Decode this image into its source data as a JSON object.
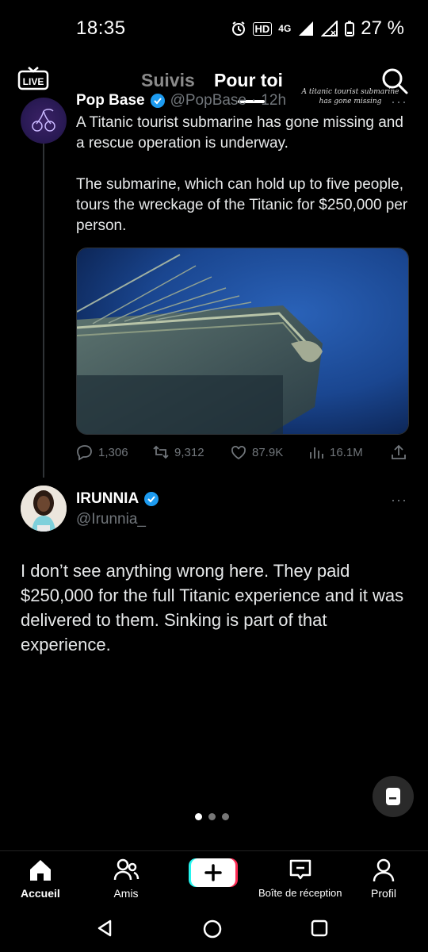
{
  "status_bar": {
    "time": "18:35",
    "network_label": "4G",
    "volte_label": "HD",
    "battery_percent": "27 %"
  },
  "top_nav": {
    "live_label": "LIVE",
    "tabs": [
      {
        "label": "Suivis",
        "active": false
      },
      {
        "label": "Pour toi",
        "active": true
      }
    ],
    "search_caption": "A titanic tourist submarine has gone missing"
  },
  "tweet": {
    "author_name": "Pop Base",
    "author_handle": "@PopBase",
    "time_ago": "12h",
    "text_p1": "A Titanic tourist submarine has gone missing and a rescue operation is underway.",
    "text_p2": "The submarine, which can hold up to five people, tours the wreckage of the Titanic for $250,000 per person.",
    "image_alt": "Titanic wreck bow",
    "replies": "1,306",
    "retweets": "9,312",
    "likes": "87.9K",
    "views": "16.1M",
    "more": "···"
  },
  "reply": {
    "author_name": "IRUNNIA",
    "author_handle": "@Irunnia_",
    "text": "I don’t see anything wrong here. They paid $250,000 for the full Titanic experience and it was delivered to them. Sinking is part of that experience.",
    "more": "···"
  },
  "pager": {
    "count": 3,
    "active_index": 0
  },
  "bottom_nav": {
    "items": [
      {
        "label": "Accueil",
        "active": true
      },
      {
        "label": "Amis",
        "active": false
      },
      {
        "label": "Boîte de réception",
        "active": false
      },
      {
        "label": "Profil",
        "active": false
      }
    ]
  },
  "colors": {
    "background": "#000000",
    "muted": "#71767b",
    "verified": "#1d9bf0",
    "create_pink": "#fe2c55",
    "create_cyan": "#25f4ee"
  }
}
